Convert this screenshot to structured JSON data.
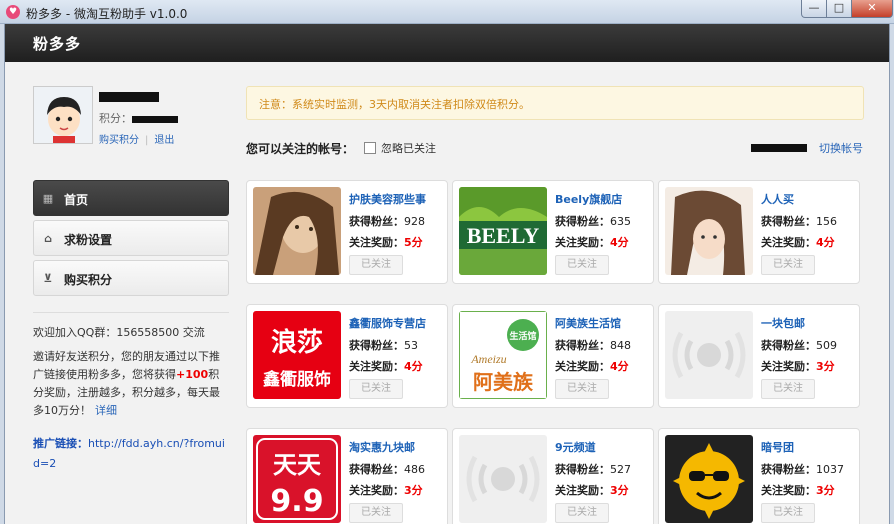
{
  "window": {
    "title": "粉多多 - 微淘互粉助手 v1.0.0",
    "min": "—",
    "max": "□",
    "close": "✕"
  },
  "header": {
    "brand": "粉多多"
  },
  "user": {
    "points_label": "积分：",
    "buy_points": "购买积分",
    "logout": "退出"
  },
  "nav": [
    {
      "label": "首页",
      "icon": "grid-icon",
      "active": true
    },
    {
      "label": "求粉设置",
      "icon": "home-icon",
      "active": false
    },
    {
      "label": "购买积分",
      "icon": "cart-icon",
      "active": false
    }
  ],
  "sidebar": {
    "qq": "欢迎加入QQ群：156558500 交流",
    "invite_pre": "邀请好友送积分，您的朋友通过以下推广链接使用粉多多，您将获得",
    "invite_bonus": "+100",
    "invite_post": "积分奖励，注册越多，积分越多，每天最多10万分！",
    "details": "详细",
    "promo_label": "推广链接：",
    "promo_url": "http://fdd.ayh.cn/?fromuid=2"
  },
  "notice": "注意：系统实时监测，3天内取消关注者扣除双倍积分。",
  "follow": {
    "title": "您可以关注的帐号：",
    "ignore": "忽略已关注",
    "switch_account": "切换帐号"
  },
  "cards": [
    {
      "name": "护肤美容那些事",
      "fans_label": "获得粉丝：",
      "fans": "928",
      "reward_label": "关注奖励：",
      "reward": "5分",
      "button": "已关注"
    },
    {
      "name": "Beely旗舰店",
      "fans_label": "获得粉丝：",
      "fans": "635",
      "reward_label": "关注奖励：",
      "reward": "4分",
      "button": "已关注"
    },
    {
      "name": "人人买",
      "fans_label": "获得粉丝：",
      "fans": "156",
      "reward_label": "关注奖励：",
      "reward": "4分",
      "button": "已关注"
    },
    {
      "name": "鑫衢服饰专营店",
      "fans_label": "获得粉丝：",
      "fans": "53",
      "reward_label": "关注奖励：",
      "reward": "4分",
      "button": "已关注"
    },
    {
      "name": "阿美族生活馆",
      "fans_label": "获得粉丝：",
      "fans": "848",
      "reward_label": "关注奖励：",
      "reward": "4分",
      "button": "已关注"
    },
    {
      "name": "一块包邮",
      "fans_label": "获得粉丝：",
      "fans": "509",
      "reward_label": "关注奖励：",
      "reward": "3分",
      "button": "已关注"
    },
    {
      "name": "淘实惠九块邮",
      "fans_label": "获得粉丝：",
      "fans": "486",
      "reward_label": "关注奖励：",
      "reward": "3分",
      "button": "已关注"
    },
    {
      "name": "9元频道",
      "fans_label": "获得粉丝：",
      "fans": "527",
      "reward_label": "关注奖励：",
      "reward": "3分",
      "button": "已关注"
    },
    {
      "name": "暗号团",
      "fans_label": "获得粉丝：",
      "fans": "1037",
      "reward_label": "关注奖励：",
      "reward": "3分",
      "button": "已关注"
    }
  ],
  "logos": {
    "beely": "BEELY",
    "langsha": "浪莎",
    "xinqu": "鑫衢服饰",
    "amei_en": "Ameizu",
    "amei": "阿美族",
    "shenghuo": "生活馆",
    "tiantian": "天天",
    "ninenine": "9.9"
  }
}
